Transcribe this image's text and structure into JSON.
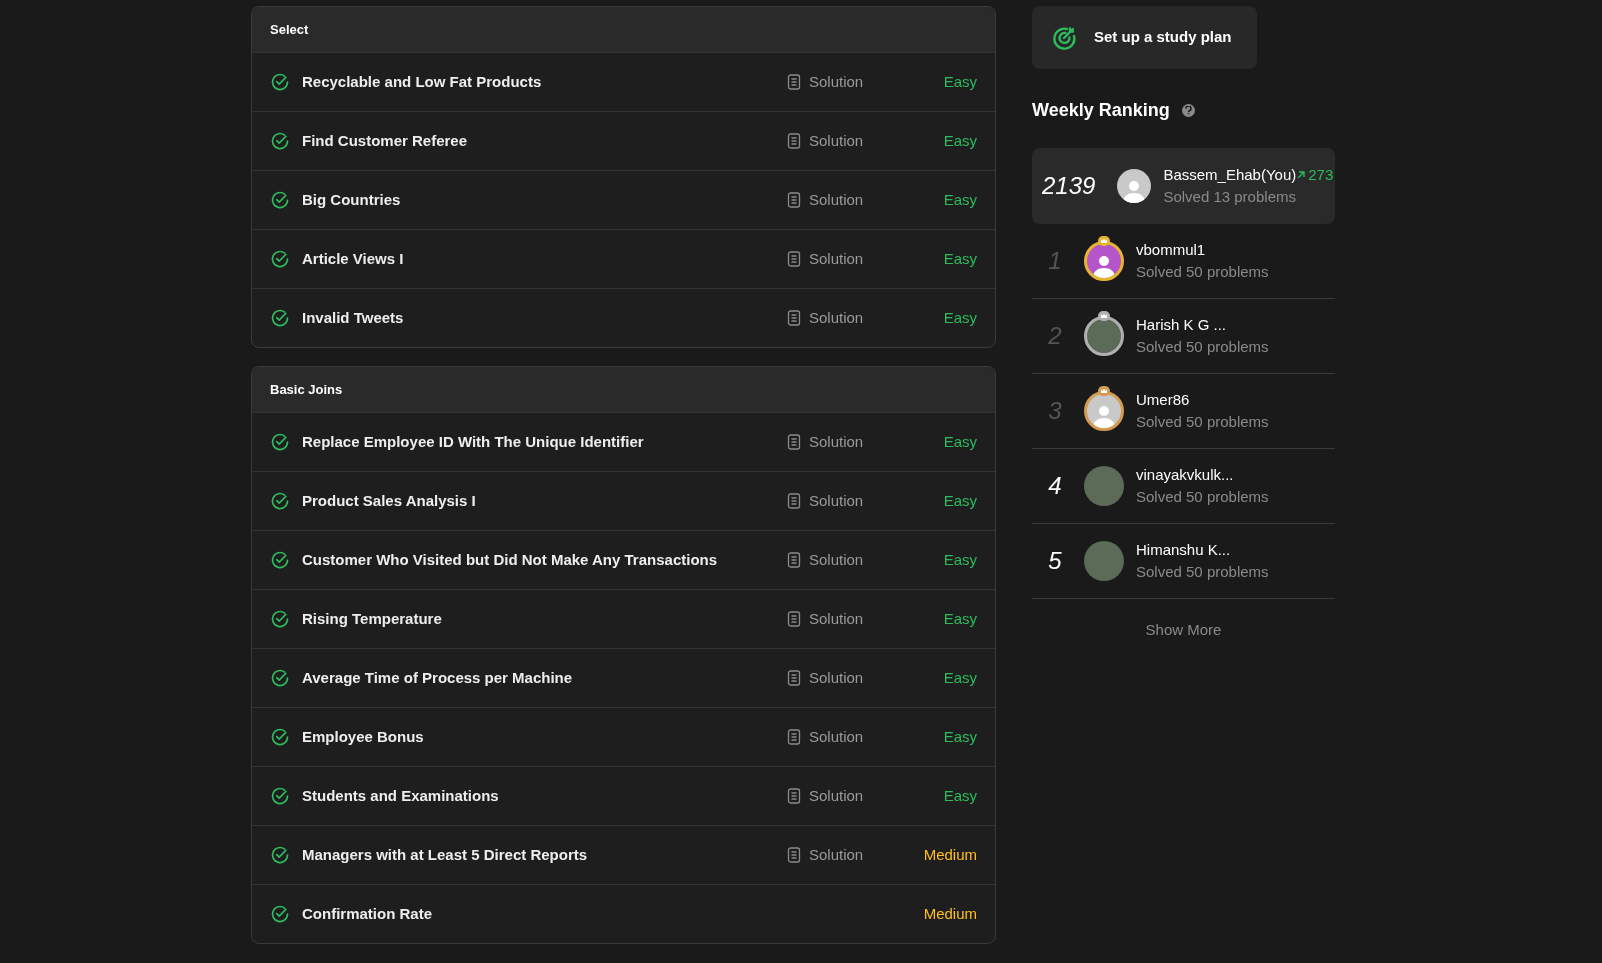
{
  "sections": [
    {
      "title": "Select",
      "problems": [
        {
          "title": "Recyclable and Low Fat Products",
          "solved": true,
          "solution": "Solution",
          "difficulty": "Easy",
          "kind": "easy"
        },
        {
          "title": "Find Customer Referee",
          "solved": true,
          "solution": "Solution",
          "difficulty": "Easy",
          "kind": "easy"
        },
        {
          "title": "Big Countries",
          "solved": true,
          "solution": "Solution",
          "difficulty": "Easy",
          "kind": "easy"
        },
        {
          "title": "Article Views I",
          "solved": true,
          "solution": "Solution",
          "difficulty": "Easy",
          "kind": "easy"
        },
        {
          "title": "Invalid Tweets",
          "solved": true,
          "solution": "Solution",
          "difficulty": "Easy",
          "kind": "easy"
        }
      ]
    },
    {
      "title": "Basic Joins",
      "problems": [
        {
          "title": "Replace Employee ID With The Unique Identifier",
          "solved": true,
          "solution": "Solution",
          "difficulty": "Easy",
          "kind": "easy"
        },
        {
          "title": "Product Sales Analysis I",
          "solved": true,
          "solution": "Solution",
          "difficulty": "Easy",
          "kind": "easy"
        },
        {
          "title": "Customer Who Visited but Did Not Make Any Transactions",
          "solved": true,
          "solution": "Solution",
          "difficulty": "Easy",
          "kind": "easy"
        },
        {
          "title": "Rising Temperature",
          "solved": true,
          "solution": "Solution",
          "difficulty": "Easy",
          "kind": "easy"
        },
        {
          "title": "Average Time of Process per Machine",
          "solved": true,
          "solution": "Solution",
          "difficulty": "Easy",
          "kind": "easy"
        },
        {
          "title": "Employee Bonus",
          "solved": true,
          "solution": "Solution",
          "difficulty": "Easy",
          "kind": "easy"
        },
        {
          "title": "Students and Examinations",
          "solved": true,
          "solution": "Solution",
          "difficulty": "Easy",
          "kind": "easy"
        },
        {
          "title": "Managers with at Least 5 Direct Reports",
          "solved": true,
          "solution": "Solution",
          "difficulty": "Medium",
          "kind": "medium"
        },
        {
          "title": "Confirmation Rate",
          "solved": true,
          "difficulty": "Medium",
          "kind": "medium"
        }
      ]
    }
  ],
  "study_plan_button": "Set up a study plan",
  "weekly_ranking": {
    "title": "Weekly Ranking",
    "you": {
      "rank": "2139",
      "name": "Bassem_Ehab(You)",
      "change": "273",
      "solved": "Solved 13 problems"
    },
    "leaders": [
      {
        "rank": "1",
        "name": "vbommul1",
        "solved": "Solved 50 problems",
        "color": "#e6b530",
        "kind": "default"
      },
      {
        "rank": "2",
        "name": "Harish K G ...",
        "solved": "Solved 50 problems",
        "color": "#b0b0b0",
        "kind": "photo"
      },
      {
        "rank": "3",
        "name": "Umer86",
        "solved": "Solved 50 problems",
        "color": "#d39a52",
        "kind": "default"
      },
      {
        "rank": "4",
        "name": "vinayakvkulk...",
        "solved": "Solved 50 problems",
        "kind": "photo"
      },
      {
        "rank": "5",
        "name": "Himanshu K...",
        "solved": "Solved 50 problems",
        "kind": "photo"
      }
    ],
    "show_more": "Show More"
  }
}
